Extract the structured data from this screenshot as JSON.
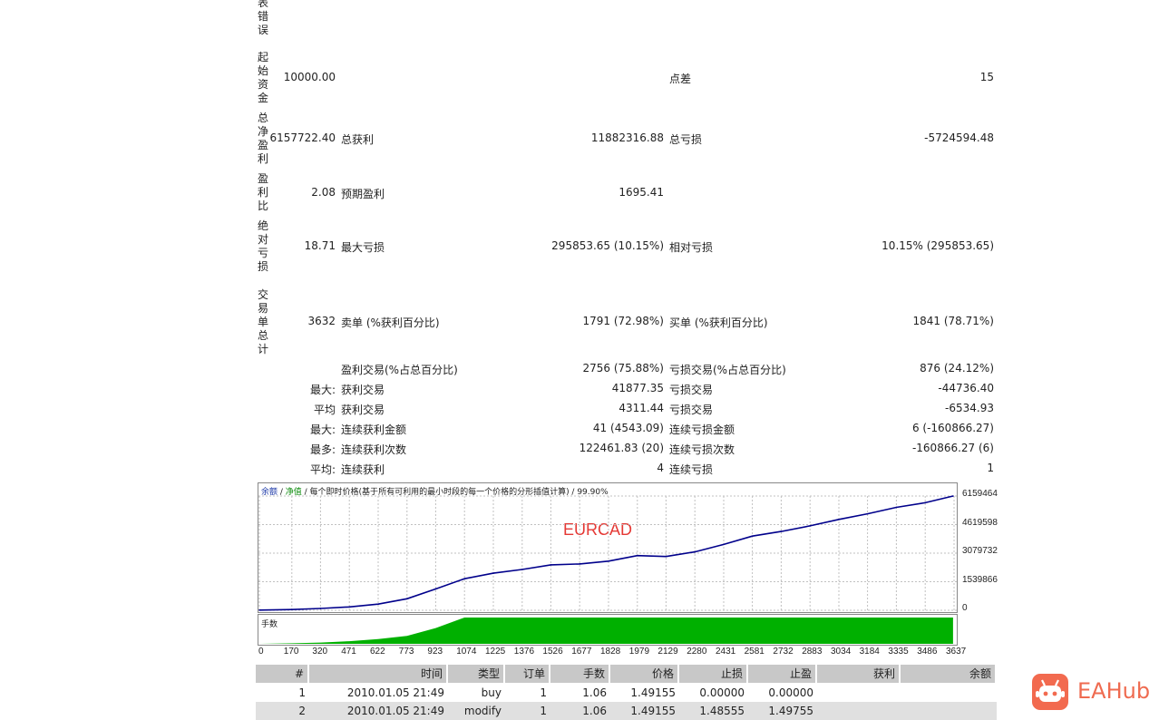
{
  "report": {
    "labels_vertical": [
      "表错误",
      "起始资金",
      "总净盈利",
      "盈利比",
      "绝对亏损",
      "交易单总计"
    ],
    "initial_deposit": "10000.00",
    "spread_label": "点差",
    "spread_value": "15",
    "net_profit": "6157722.40",
    "gross_profit_label": "总获利",
    "gross_profit": "11882316.88",
    "gross_loss_label": "总亏损",
    "gross_loss": "-5724594.48",
    "profit_factor": "2.08",
    "expected_payoff_label": "预期盈利",
    "expected_payoff": "1695.41",
    "absolute_drawdown": "18.71",
    "max_drawdown_label": "最大亏损",
    "max_drawdown": "295853.65 (10.15%)",
    "relative_drawdown_label": "相对亏损",
    "relative_drawdown": "10.15% (295853.65)",
    "total_trades": "3632",
    "short_label": "卖单 (%获利百分比)",
    "short_value": "1791 (72.98%)",
    "long_label": "买单 (%获利百分比)",
    "long_value": "1841 (78.71%)",
    "profit_trades_label": "盈利交易(%占总百分比)",
    "profit_trades": "2756 (75.88%)",
    "loss_trades_label": "亏损交易(%占总百分比)",
    "loss_trades": "876 (24.12%)",
    "max_label": "最大:",
    "largest_profit_label": "获利交易",
    "largest_profit": "41877.35",
    "largest_loss_label": "亏损交易",
    "largest_loss": "-44736.40",
    "avg_label": "平均",
    "avg_profit_label": "获利交易",
    "avg_profit": "4311.44",
    "avg_loss_label": "亏损交易",
    "avg_loss": "-6534.93",
    "max2_label": "最大:",
    "max_consec_win_label": "连续获利金额",
    "max_consec_win": "41 (4543.09)",
    "max_consec_loss_label": "连续亏损金额",
    "max_consec_loss": "6 (-160866.27)",
    "maximal_label": "最多:",
    "maximal_consec_win_label": "连续获利次数",
    "maximal_consec_win": "122461.83 (20)",
    "maximal_consec_loss_label": "连续亏损次数",
    "maximal_consec_loss": "-160866.27 (6)",
    "avg2_label": "平均:",
    "avg_consec_win_label": "连续获利",
    "avg_consec_win": "4",
    "avg_consec_loss_label": "连续亏损",
    "avg_consec_loss": "1"
  },
  "chart_data": {
    "type": "line",
    "header_balance": "余额",
    "header_sep": " / ",
    "header_equity": "净值",
    "header_rest": " / 每个即时价格(基于所有可利用的最小时段的每一个价格的分形插值计算) / 99.90%",
    "overlay_label": "EURCAD",
    "y_ticks": [
      "6159464",
      "4619598",
      "3079732",
      "1539866",
      "0"
    ],
    "ylim": [
      0,
      6159464
    ],
    "x_ticks": [
      "0",
      "170",
      "320",
      "471",
      "622",
      "773",
      "923",
      "1074",
      "1225",
      "1376",
      "1526",
      "1677",
      "1828",
      "1979",
      "2129",
      "2280",
      "2431",
      "2581",
      "2732",
      "2883",
      "3034",
      "3184",
      "3335",
      "3486",
      "3637"
    ],
    "x": [
      0,
      170,
      320,
      471,
      622,
      773,
      923,
      1074,
      1225,
      1376,
      1526,
      1677,
      1828,
      1979,
      2129,
      2280,
      2431,
      2581,
      2732,
      2883,
      3034,
      3184,
      3335,
      3486,
      3632
    ],
    "series": [
      {
        "values": [
          10000,
          40000,
          100000,
          180000,
          330000,
          620000,
          1150000,
          1700000,
          2000000,
          2200000,
          2450000,
          2500000,
          2650000,
          2950000,
          2900000,
          3150000,
          3550000,
          4000000,
          4250000,
          4550000,
          4900000,
          5200000,
          5550000,
          5800000,
          6157722
        ]
      }
    ],
    "lots_label": "手数",
    "lots_series": {
      "values": [
        0,
        0.02,
        0.05,
        0.1,
        0.18,
        0.3,
        0.6,
        1.0,
        1.0,
        1.0,
        1.0,
        1.0,
        1.0,
        1.0,
        1.0,
        1.0,
        1.0,
        1.0,
        1.0,
        1.0,
        1.0,
        1.0,
        1.0,
        1.0,
        1.0
      ]
    },
    "colors": {
      "balance": "#00008b",
      "lots": "#00b000",
      "grid": "#c0c0c0",
      "overlay": "#e53935"
    }
  },
  "trades_table": {
    "headers": [
      "#",
      "时间",
      "类型",
      "订单",
      "手数",
      "价格",
      "止损",
      "止盈",
      "获利",
      "余额"
    ],
    "rows": [
      [
        "1",
        "2010.01.05 21:49",
        "buy",
        "1",
        "1.06",
        "1.49155",
        "0.00000",
        "0.00000",
        "",
        ""
      ],
      [
        "2",
        "2010.01.05 21:49",
        "modify",
        "1",
        "1.06",
        "1.49155",
        "1.48555",
        "1.49755",
        "",
        ""
      ]
    ]
  },
  "brand": {
    "name": "EAHub"
  }
}
